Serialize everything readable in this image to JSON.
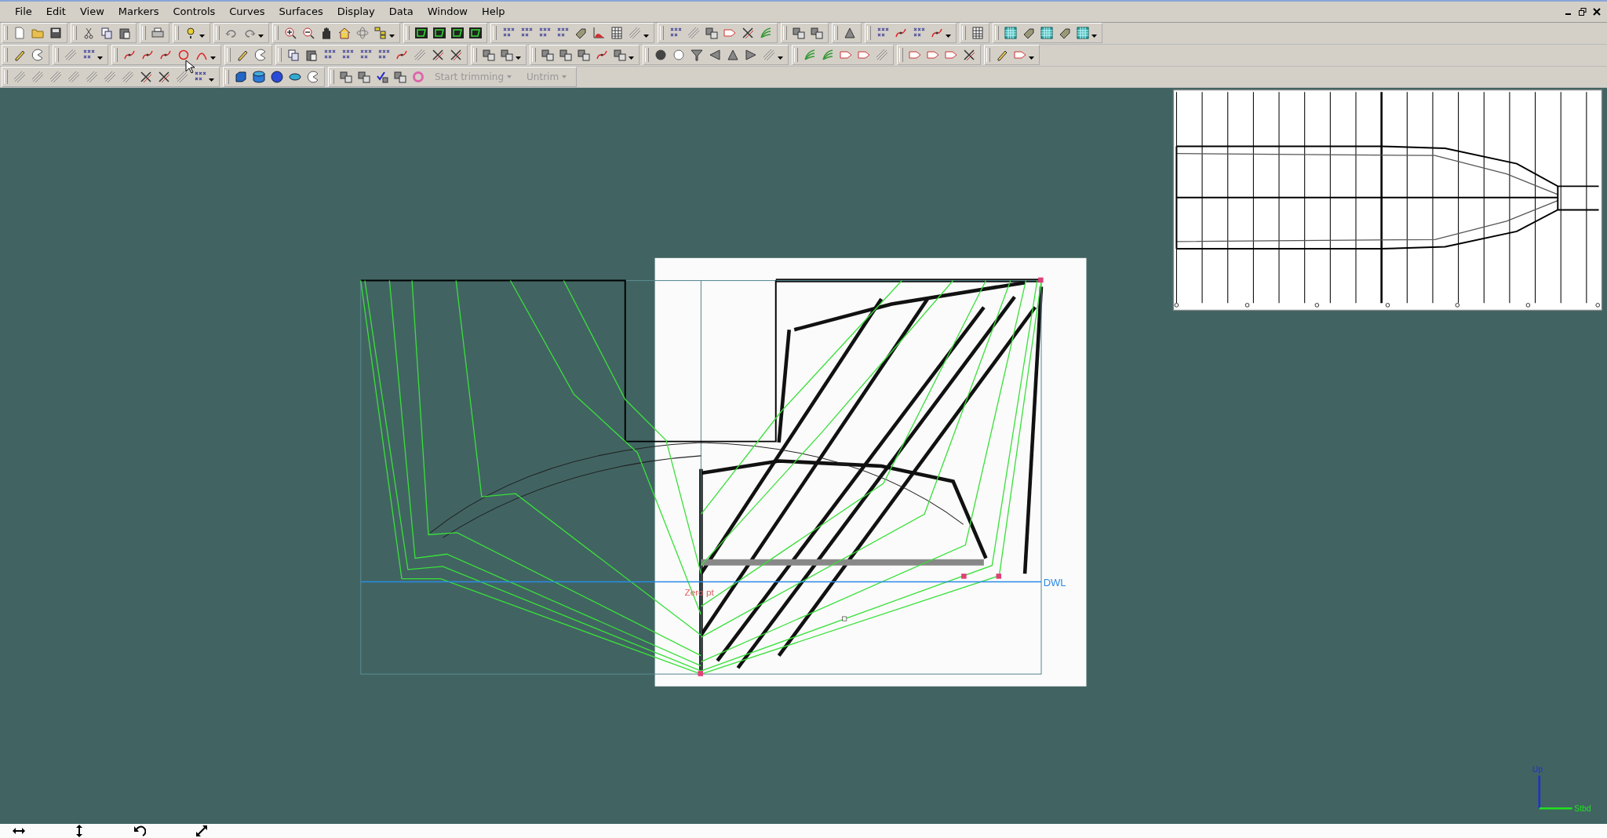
{
  "menu": [
    {
      "label": "File"
    },
    {
      "label": "Edit"
    },
    {
      "label": "View"
    },
    {
      "label": "Markers"
    },
    {
      "label": "Controls"
    },
    {
      "label": "Curves"
    },
    {
      "label": "Surfaces"
    },
    {
      "label": "Display"
    },
    {
      "label": "Data"
    },
    {
      "label": "Window"
    },
    {
      "label": "Help"
    }
  ],
  "trim_buttons": [
    {
      "label": "Start trimming",
      "disabled": true
    },
    {
      "label": "Untrim",
      "disabled": true
    }
  ],
  "canvas": {
    "waterline_label": "DWL",
    "zero_point_label": "Zero pt",
    "axis_up_label": "Up",
    "axis_side_label": "Stbd"
  }
}
